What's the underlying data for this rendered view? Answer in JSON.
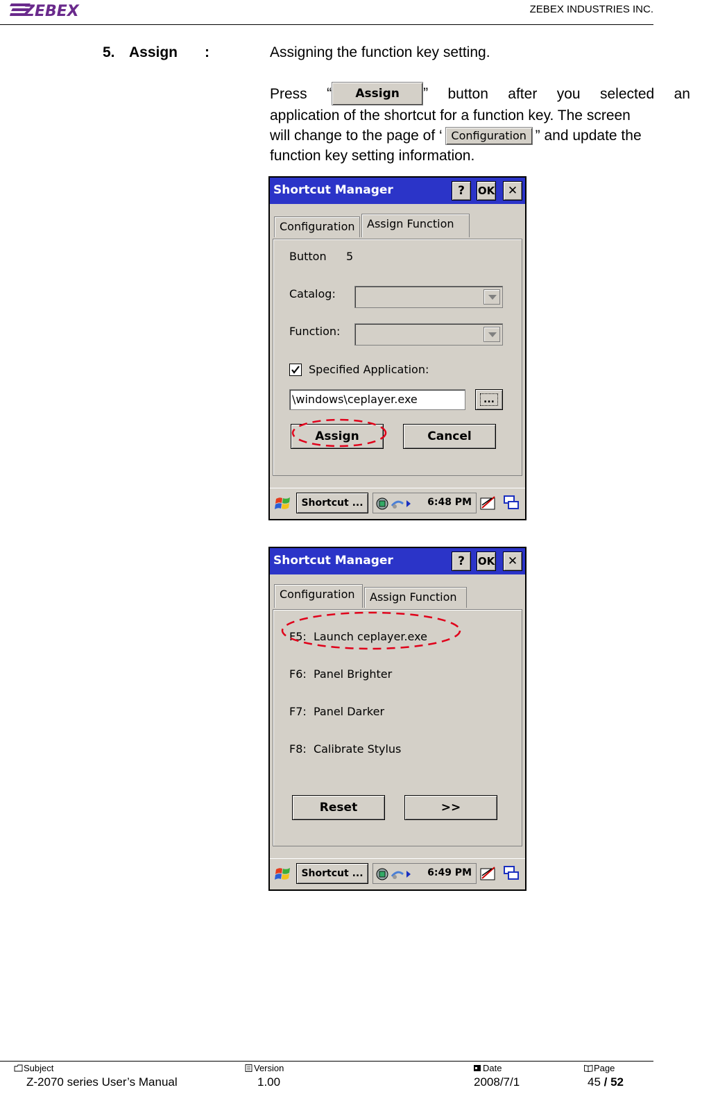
{
  "header": {
    "logo_text": "ZEBEX",
    "company": "ZEBEX INDUSTRIES INC."
  },
  "section": {
    "number": "5.",
    "title": "Assign",
    "colon": ":",
    "description": "Assigning the function key setting."
  },
  "paragraph": {
    "word_press": "Press",
    "open_quote": "“",
    "assign_button": "Assign",
    "close_quote": "”",
    "w_button": "button",
    "w_after": "after",
    "w_you": "you",
    "w_selected": "selected",
    "w_an": "an",
    "line2": "application of the shortcut for a function key. The screen",
    "line3_pre": "will change to the page of ‘",
    "config_button": "Configuration",
    "line3_post": "” and update the",
    "line4": "function key setting information."
  },
  "screen1": {
    "title": "Shortcut Manager",
    "help_btn": "?",
    "ok_btn": "OK",
    "close_btn": "✕",
    "tab_configuration": "Configuration",
    "tab_assign_function": "Assign Function",
    "button_label": "Button",
    "button_number": "5",
    "catalog_label": "Catalog:",
    "function_label": "Function:",
    "specified_app_label": "Specified Application:",
    "specified_app_checked": true,
    "app_path": "\\windows\\ceplayer.exe",
    "browse_btn": "...",
    "assign_btn": "Assign",
    "cancel_btn": "Cancel",
    "taskbar_task": "Shortcut ...",
    "clock": "6:48 PM"
  },
  "screen2": {
    "title": "Shortcut Manager",
    "help_btn": "?",
    "ok_btn": "OK",
    "close_btn": "✕",
    "tab_configuration": "Configuration",
    "tab_assign_function": "Assign Function",
    "items": [
      {
        "key": "F5:",
        "action": "Launch ceplayer.exe"
      },
      {
        "key": "F6:",
        "action": "Panel Brighter"
      },
      {
        "key": "F7:",
        "action": "Panel Darker"
      },
      {
        "key": "F8:",
        "action": "Calibrate Stylus"
      }
    ],
    "reset_btn": "Reset",
    "next_btn": ">>",
    "taskbar_task": "Shortcut ...",
    "clock": "6:49 PM"
  },
  "footer": {
    "subject_label": "Subject",
    "subject_value": "Z-2070 series User’s Manual",
    "version_label": "Version",
    "version_value": "1.00",
    "date_label": "Date",
    "date_value": "2008/7/1",
    "page_label": "Page",
    "page_current": "45",
    "page_sep": " / ",
    "page_total": "52"
  },
  "colors": {
    "titlebar": "#2b34c8",
    "highlight_ellipse": "#e0001a",
    "window_face": "#d4d0c8"
  }
}
